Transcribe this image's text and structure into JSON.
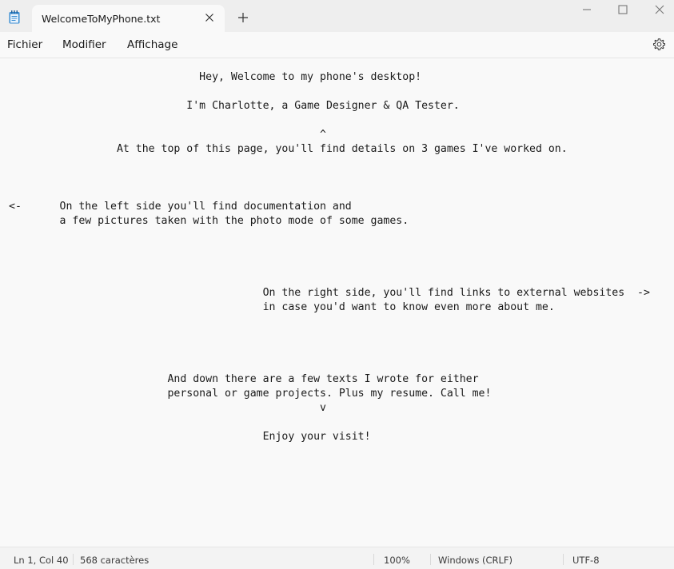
{
  "tab": {
    "title": "WelcomeToMyPhone.txt",
    "icon": "notepad-icon"
  },
  "menu": {
    "items": [
      "Fichier",
      "Modifier",
      "Affichage"
    ],
    "settings_icon": "gear-icon"
  },
  "document": {
    "lines": [
      "                              Hey, Welcome to my phone's desktop!",
      "",
      "                            I'm Charlotte, a Game Designer & QA Tester.",
      "",
      "                                                 ^",
      "                 At the top of this page, you'll find details on 3 games I've worked on.",
      "",
      "",
      "",
      "<-      On the left side you'll find documentation and",
      "        a few pictures taken with the photo mode of some games.",
      "",
      "",
      "",
      "",
      "                                        On the right side, you'll find links to external websites  ->",
      "                                        in case you'd want to know even more about me.",
      "",
      "",
      "",
      "",
      "                         And down there are a few texts I wrote for either",
      "                         personal or game projects. Plus my resume. Call me!",
      "                                                 v",
      "",
      "                                        Enjoy your visit!"
    ]
  },
  "status": {
    "position": "Ln 1, Col 40",
    "char_count": "568 caractères",
    "zoom": "100%",
    "line_ending": "Windows (CRLF)",
    "encoding": "UTF-8"
  }
}
